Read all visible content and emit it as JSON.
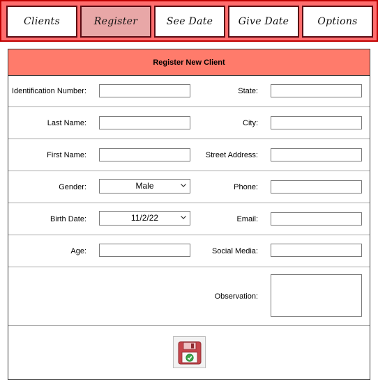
{
  "nav": {
    "tabs": [
      {
        "label": "Clients",
        "active": false
      },
      {
        "label": "Register",
        "active": true
      },
      {
        "label": "See Date",
        "active": false
      },
      {
        "label": "Give Date",
        "active": false
      },
      {
        "label": "Options",
        "active": false
      }
    ]
  },
  "form": {
    "title": "Register New Client",
    "left_fields": {
      "identification": {
        "label": "Identification Number:",
        "value": ""
      },
      "last_name": {
        "label": "Last Name:",
        "value": ""
      },
      "first_name": {
        "label": "First Name:",
        "value": ""
      },
      "gender": {
        "label": "Gender:",
        "selected": "Male"
      },
      "birth_date": {
        "label": "Birth Date:",
        "selected": "11/2/22"
      },
      "age": {
        "label": "Age:",
        "value": ""
      }
    },
    "right_fields": {
      "state": {
        "label": "State:",
        "value": ""
      },
      "city": {
        "label": "City:",
        "value": ""
      },
      "street_address": {
        "label": "Street Address:",
        "value": ""
      },
      "phone": {
        "label": "Phone:",
        "value": ""
      },
      "email": {
        "label": "Email:",
        "value": ""
      },
      "social_media": {
        "label": "Social Media:",
        "value": ""
      },
      "observation": {
        "label": "Observation:",
        "value": ""
      }
    },
    "save_icon": "save-disk-icon"
  },
  "colors": {
    "nav_bg": "#ff6d6d",
    "nav_border": "#c00000",
    "tab_active_bg": "#e8a7a7",
    "header_bg": "#ff7b6b"
  }
}
